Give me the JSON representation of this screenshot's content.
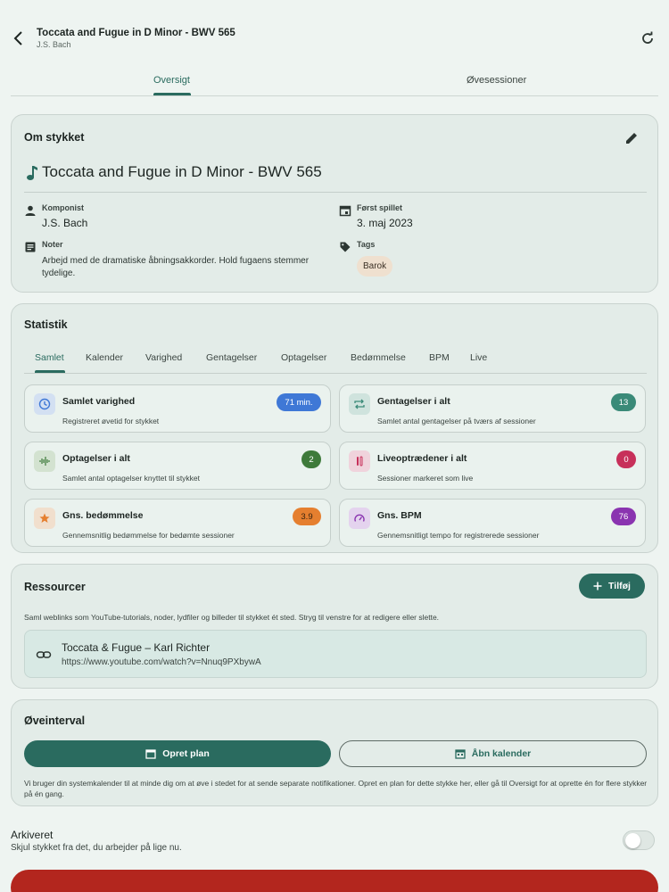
{
  "header": {
    "title": "Toccata and Fugue in D Minor - BWV 565",
    "subtitle": "J.S. Bach"
  },
  "main_tabs": [
    {
      "label": "Oversigt",
      "active": true
    },
    {
      "label": "Øvesessioner",
      "active": false
    }
  ],
  "about": {
    "title": "Om stykket",
    "piece_title": "Toccata and Fugue in D Minor - BWV 565",
    "composer_label": "Komponist",
    "composer": "J.S. Bach",
    "first_played_label": "Først spillet",
    "first_played": "3. maj 2023",
    "notes_label": "Noter",
    "notes": "Arbejd med de dramatiske åbningsakkorder. Hold fugaens stemmer tydelige.",
    "tags_label": "Tags",
    "tags": [
      "Barok"
    ]
  },
  "stats": {
    "title": "Statistik",
    "tabs": [
      "Samlet",
      "Kalender",
      "Varighed",
      "Gentagelser",
      "Optagelser",
      "Bedømmelse",
      "BPM",
      "Live"
    ],
    "active_tab": "Samlet",
    "items": [
      {
        "label": "Samlet varighed",
        "desc": "Registreret øvetid for stykket",
        "value": "71 min.",
        "color": "#3f78d6",
        "icon": "clock-icon"
      },
      {
        "label": "Gentagelser i alt",
        "desc": "Samlet antal gentagelser på tværs af sessioner",
        "value": "13",
        "color": "#3a8a78",
        "icon": "repeat-icon"
      },
      {
        "label": "Optagelser i alt",
        "desc": "Samlet antal optagelser knyttet til stykket",
        "value": "2",
        "color": "#3e7a3a",
        "icon": "audio-wave-icon"
      },
      {
        "label": "Liveoptrædener i alt",
        "desc": "Sessioner markeret som live",
        "value": "0",
        "color": "#c7305a",
        "icon": "microphone-icon"
      },
      {
        "label": "Gns. bedømmelse",
        "desc": "Gennemsnitlig bedømmelse for bedømte sessioner",
        "value": "3.9",
        "color": "#e57f2f",
        "icon": "star-icon"
      },
      {
        "label": "Gns. BPM",
        "desc": "Gennemsnitligt tempo for registrerede sessioner",
        "value": "76",
        "color": "#8a34b0",
        "icon": "speedometer-icon"
      }
    ]
  },
  "resources": {
    "title": "Ressourcer",
    "add_label": "Tilføj",
    "desc": "Saml weblinks som YouTube-tutorials, noder, lydfiler og billeder til stykket ét sted. Stryg til venstre for at redigere eller slette.",
    "items": [
      {
        "name": "Toccata & Fugue – Karl Richter",
        "url": "https://www.youtube.com/watch?v=Nnuq9PXbywA"
      }
    ]
  },
  "practice": {
    "title": "Øveinterval",
    "plan_label": "Opret plan",
    "calendar_label": "Åbn kalender",
    "desc": "Vi bruger din systemkalender til at minde dig om at øve i stedet for at sende separate notifikationer. Opret en plan for dette stykke her, eller gå til Oversigt for at oprette én for flere stykker på én gang."
  },
  "archive": {
    "title": "Arkiveret",
    "desc": "Skjul stykket fra det, du arbejder på lige nu.",
    "on": false
  }
}
